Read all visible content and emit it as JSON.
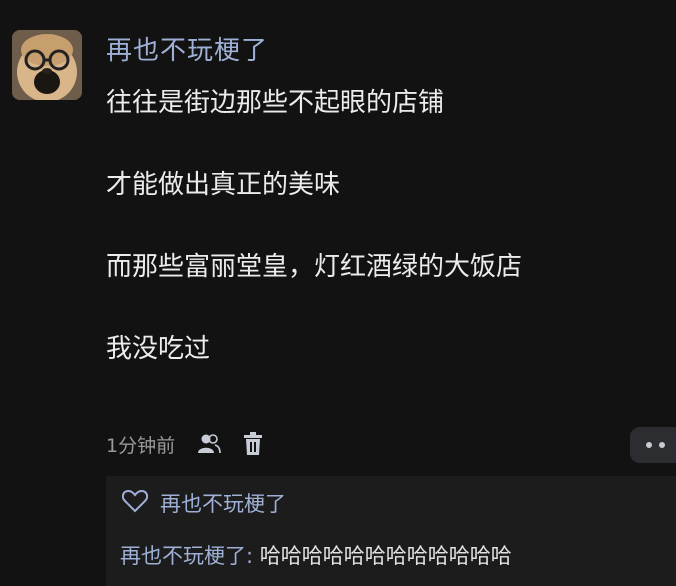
{
  "post": {
    "username": "再也不玩梗了",
    "lines": [
      "往往是街边那些不起眼的店铺",
      "才能做出真正的美味",
      "而那些富丽堂皇，灯红酒绿的大饭店",
      "我没吃过"
    ],
    "time": "1分钟前",
    "icons": {
      "avatar": "dog-photo-avatar",
      "users": "users-icon",
      "delete": "trash-icon",
      "more": "more-dots-icon",
      "like": "heart-outline-icon"
    }
  },
  "replies": {
    "liked_by": "再也不玩梗了",
    "reply_name": "再也不玩梗了:",
    "reply_text": " 哈哈哈哈哈哈哈哈哈哈哈哈"
  },
  "colors": {
    "background": "#121212",
    "username": "#9fb0d6",
    "text": "#ececec"
  }
}
